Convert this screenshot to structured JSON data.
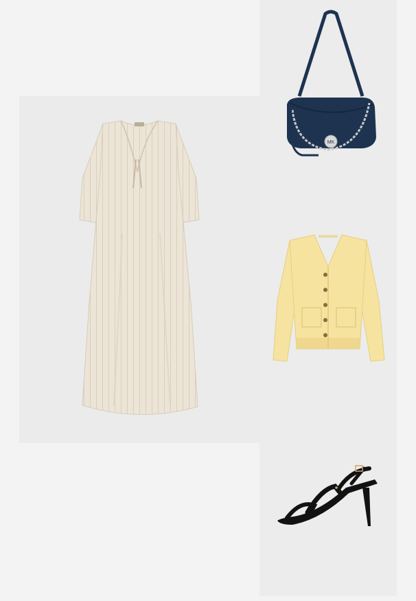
{
  "board": {
    "background": "#f3f3f3",
    "tile_background": "#ececec"
  },
  "items": [
    {
      "kind": "dress",
      "color": "#ece4d6",
      "stripe_color": "#d8cdb9"
    },
    {
      "kind": "shoulder-bag",
      "color": "#1d3350",
      "hardware_color": "#c9c9c9",
      "logo_text": "MK"
    },
    {
      "kind": "cardigan",
      "color": "#f6e3a0",
      "button_color": "#8a6a3f"
    },
    {
      "kind": "sandal",
      "color": "#121212"
    }
  ]
}
